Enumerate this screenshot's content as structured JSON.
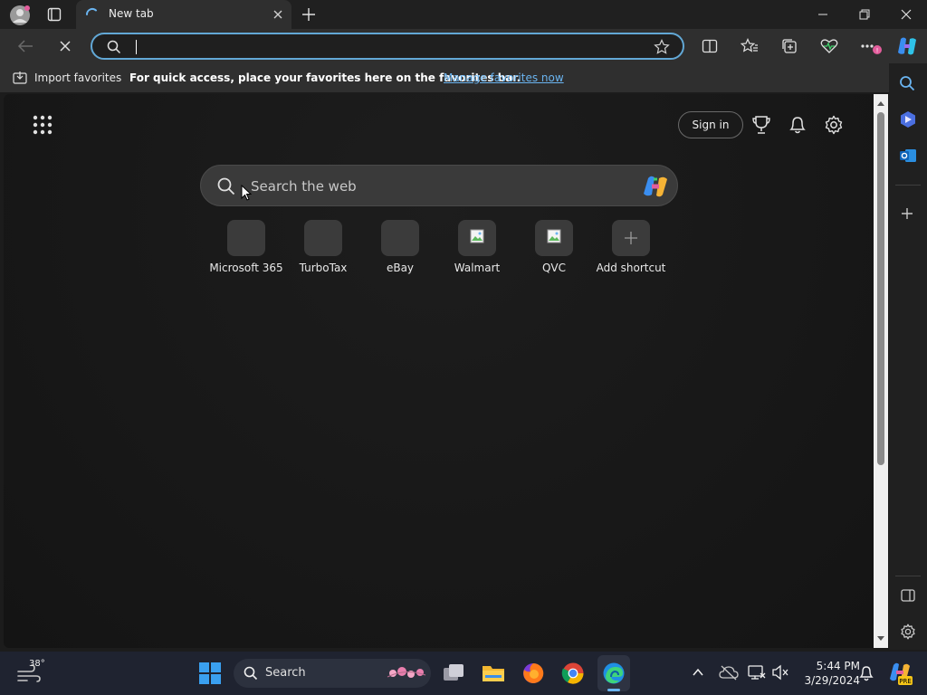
{
  "tab": {
    "title": "New tab"
  },
  "address_bar": {
    "value": "",
    "placeholder": ""
  },
  "favorites_bar": {
    "import_label": "Import favorites",
    "message": "For quick access, place your favorites here on the favorites bar.",
    "manage_link": "Manage favorites now"
  },
  "newtab": {
    "signin_label": "Sign in",
    "search_placeholder": "Search the web",
    "shortcuts": [
      {
        "label": "Microsoft 365"
      },
      {
        "label": "TurboTax"
      },
      {
        "label": "eBay"
      },
      {
        "label": "Walmart"
      },
      {
        "label": "QVC"
      },
      {
        "label": "Add shortcut"
      }
    ]
  },
  "taskbar": {
    "weather_temp": "38°",
    "search_label": "Search",
    "time": "5:44 PM",
    "date": "3/29/2024"
  },
  "colors": {
    "accent": "#62a8d6",
    "link": "#6ab4f0",
    "windows_blue": "#3aa0f0"
  }
}
